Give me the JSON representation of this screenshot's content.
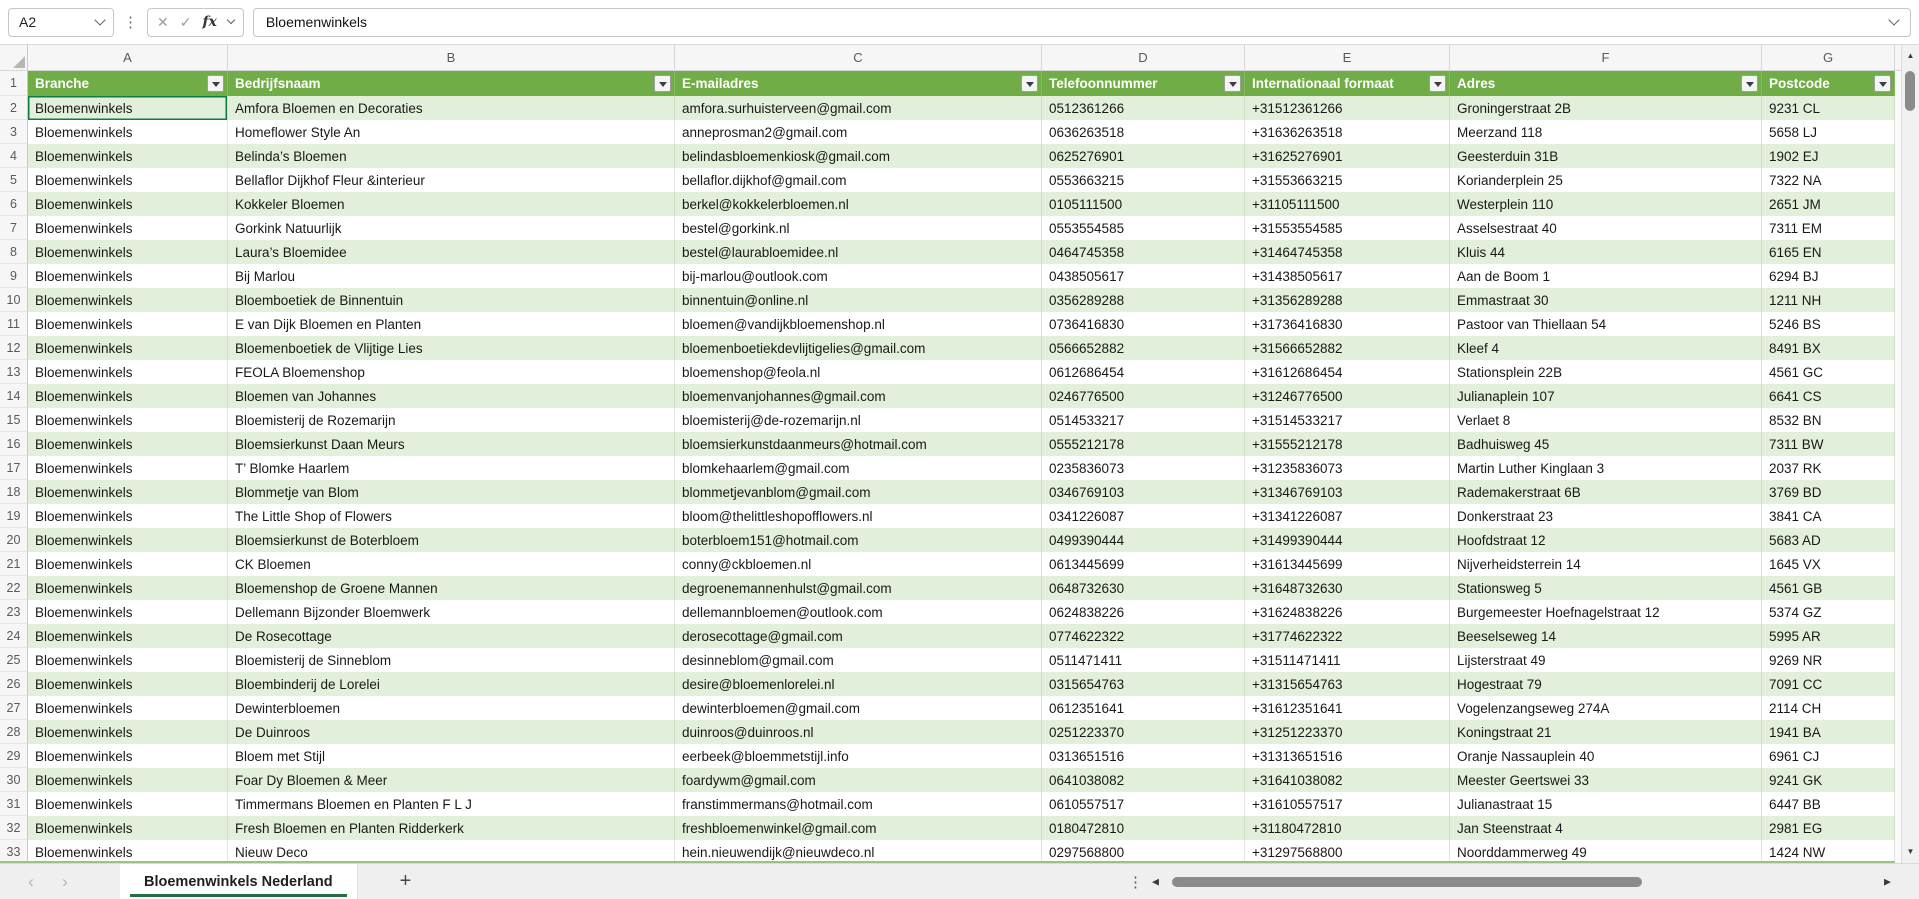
{
  "formula_bar": {
    "name_box_value": "A2",
    "value": "Bloemenwinkels"
  },
  "icons": {
    "name_box_dropdown": "chevron-down",
    "cancel": "✕",
    "confirm": "✓",
    "function": "fx",
    "filter_dropdown": "▼",
    "select_all": "triangle",
    "tab_prev": "‹",
    "tab_next": "›",
    "add_sheet": "+",
    "more": "⋮",
    "scroll_up": "▲",
    "scroll_down": "▼",
    "scroll_left": "◀",
    "scroll_right": "▶"
  },
  "colors": {
    "header_green": "#70AD47",
    "band_green": "#E2EFDA",
    "selection_green": "#107C41",
    "tab_underline_green": "#1E7145",
    "table_bottom_border": "#9CC37E"
  },
  "sheet": {
    "column_letters": [
      "A",
      "B",
      "C",
      "D",
      "E",
      "F",
      "G"
    ],
    "selected_cell": "A2",
    "first_row_number": 1
  },
  "table": {
    "headers": [
      "Branche",
      "Bedrijfsnaam",
      "E-mailadres",
      "Telefoonnummer",
      "Internationaal formaat",
      "Adres",
      "Postcode"
    ],
    "rows": [
      [
        "Bloemenwinkels",
        "Amfora Bloemen en Decoraties",
        "amfora.surhuisterveen@gmail.com",
        "0512361266",
        "+31512361266",
        "Groningerstraat 2B",
        "9231 CL"
      ],
      [
        "Bloemenwinkels",
        "Homeflower Style An",
        "anneprosman2@gmail.com",
        "0636263518",
        "+31636263518",
        "Meerzand 118",
        "5658 LJ"
      ],
      [
        "Bloemenwinkels",
        "Belinda’s Bloemen",
        "belindasbloemenkiosk@gmail.com",
        "0625276901",
        "+31625276901",
        "Geesterduin 31B",
        "1902 EJ"
      ],
      [
        "Bloemenwinkels",
        "Bellaflor Dijkhof Fleur &interieur",
        "bellaflor.dijkhof@gmail.com",
        "0553663215",
        "+31553663215",
        "Korianderplein 25",
        "7322 NA"
      ],
      [
        "Bloemenwinkels",
        "Kokkeler Bloemen",
        "berkel@kokkelerbloemen.nl",
        "0105111500",
        "+31105111500",
        "Westerplein 110",
        "2651 JM"
      ],
      [
        "Bloemenwinkels",
        "Gorkink Natuurlijk",
        "bestel@gorkink.nl",
        "0553554585",
        "+31553554585",
        "Asselsestraat 40",
        "7311 EM"
      ],
      [
        "Bloemenwinkels",
        "Laura’s Bloemidee",
        "bestel@laurabloemidee.nl",
        "0464745358",
        "+31464745358",
        "Kluis 44",
        "6165 EN"
      ],
      [
        "Bloemenwinkels",
        "Bij Marlou",
        "bij-marlou@outlook.com",
        "0438505617",
        "+31438505617",
        "Aan de Boom 1",
        "6294 BJ"
      ],
      [
        "Bloemenwinkels",
        "Bloemboetiek de Binnentuin",
        "binnentuin@online.nl",
        "0356289288",
        "+31356289288",
        "Emmastraat 30",
        "1211 NH"
      ],
      [
        "Bloemenwinkels",
        "E van Dijk Bloemen en Planten",
        "bloemen@vandijkbloemenshop.nl",
        "0736416830",
        "+31736416830",
        "Pastoor van Thiellaan 54",
        "5246 BS"
      ],
      [
        "Bloemenwinkels",
        "Bloemenboetiek de Vlijtige Lies",
        "bloemenboetiekdevlijtigelies@gmail.com",
        "0566652882",
        "+31566652882",
        "Kleef 4",
        "8491 BX"
      ],
      [
        "Bloemenwinkels",
        "FEOLA Bloemenshop",
        "bloemenshop@feola.nl",
        "0612686454",
        "+31612686454",
        "Stationsplein 22B",
        "4561 GC"
      ],
      [
        "Bloemenwinkels",
        "Bloemen van Johannes",
        "bloemenvanjohannes@gmail.com",
        "0246776500",
        "+31246776500",
        "Julianaplein 107",
        "6641 CS"
      ],
      [
        "Bloemenwinkels",
        "Bloemisterij de Rozemarijn",
        "bloemisterij@de-rozemarijn.nl",
        "0514533217",
        "+31514533217",
        "Verlaet 8",
        "8532 BN"
      ],
      [
        "Bloemenwinkels",
        "Bloemsierkunst Daan Meurs",
        "bloemsierkunstdaanmeurs@hotmail.com",
        "0555212178",
        "+31555212178",
        "Badhuisweg 45",
        "7311 BW"
      ],
      [
        "Bloemenwinkels",
        "T’ Blomke Haarlem",
        "blomkehaarlem@gmail.com",
        "0235836073",
        "+31235836073",
        "Martin Luther Kinglaan 3",
        "2037 RK"
      ],
      [
        "Bloemenwinkels",
        "Blommetje van Blom",
        "blommetjevanblom@gmail.com",
        "0346769103",
        "+31346769103",
        "Rademakerstraat 6B",
        "3769 BD"
      ],
      [
        "Bloemenwinkels",
        "The Little Shop of Flowers",
        "bloom@thelittleshopofflowers.nl",
        "0341226087",
        "+31341226087",
        "Donkerstraat 23",
        "3841 CA"
      ],
      [
        "Bloemenwinkels",
        "Bloemsierkunst de Boterbloem",
        "boterbloem151@hotmail.com",
        "0499390444",
        "+31499390444",
        "Hoofdstraat 12",
        "5683 AD"
      ],
      [
        "Bloemenwinkels",
        "CK Bloemen",
        "conny@ckbloemen.nl",
        "0613445699",
        "+31613445699",
        "Nijverheidsterrein 14",
        "1645 VX"
      ],
      [
        "Bloemenwinkels",
        "Bloemenshop de Groene Mannen",
        "degroenemannenhulst@gmail.com",
        "0648732630",
        "+31648732630",
        "Stationsweg 5",
        "4561 GB"
      ],
      [
        "Bloemenwinkels",
        "Dellemann Bijzonder Bloemwerk",
        "dellemannbloemen@outlook.com",
        "0624838226",
        "+31624838226",
        "Burgemeester Hoefnagelstraat 12",
        "5374 GZ"
      ],
      [
        "Bloemenwinkels",
        "De Rosecottage",
        "derosecottage@gmail.com",
        "0774622322",
        "+31774622322",
        "Beeselseweg 14",
        "5995 AR"
      ],
      [
        "Bloemenwinkels",
        "Bloemisterij de Sinneblom",
        "desinneblom@gmail.com",
        "0511471411",
        "+31511471411",
        "Lijsterstraat 49",
        "9269 NR"
      ],
      [
        "Bloemenwinkels",
        "Bloembinderij de Lorelei",
        "desire@bloemenlorelei.nl",
        "0315654763",
        "+31315654763",
        "Hogestraat 79",
        "7091 CC"
      ],
      [
        "Bloemenwinkels",
        "Dewinterbloemen",
        "dewinterbloemen@gmail.com",
        "0612351641",
        "+31612351641",
        "Vogelenzangseweg 274A",
        "2114 CH"
      ],
      [
        "Bloemenwinkels",
        "De Duinroos",
        "duinroos@duinroos.nl",
        "0251223370",
        "+31251223370",
        "Koningstraat 21",
        "1941 BA"
      ],
      [
        "Bloemenwinkels",
        "Bloem met Stijl",
        "eerbeek@bloemmetstijl.info",
        "0313651516",
        "+31313651516",
        "Oranje Nassauplein 40",
        "6961 CJ"
      ],
      [
        "Bloemenwinkels",
        "Foar Dy Bloemen & Meer",
        "foardywm@gmail.com",
        "0641038082",
        "+31641038082",
        "Meester Geertswei 33",
        "9241 GK"
      ],
      [
        "Bloemenwinkels",
        "Timmermans Bloemen en Planten F L J",
        "franstimmermans@hotmail.com",
        "0610557517",
        "+31610557517",
        "Julianastraat 15",
        "6447 BB"
      ],
      [
        "Bloemenwinkels",
        "Fresh Bloemen en Planten Ridderkerk",
        "freshbloemenwinkel@gmail.com",
        "0180472810",
        "+31180472810",
        "Jan Steenstraat 4",
        "2981 EG"
      ],
      [
        "Bloemenwinkels",
        "Nieuw Deco",
        "hein.nieuwendijk@nieuwdeco.nl",
        "0297568800",
        "+31297568800",
        "Noorddammerweg 49",
        "1424 NW"
      ]
    ]
  },
  "sheet_tabs": {
    "active_tab": "Bloemenwinkels Nederland"
  }
}
